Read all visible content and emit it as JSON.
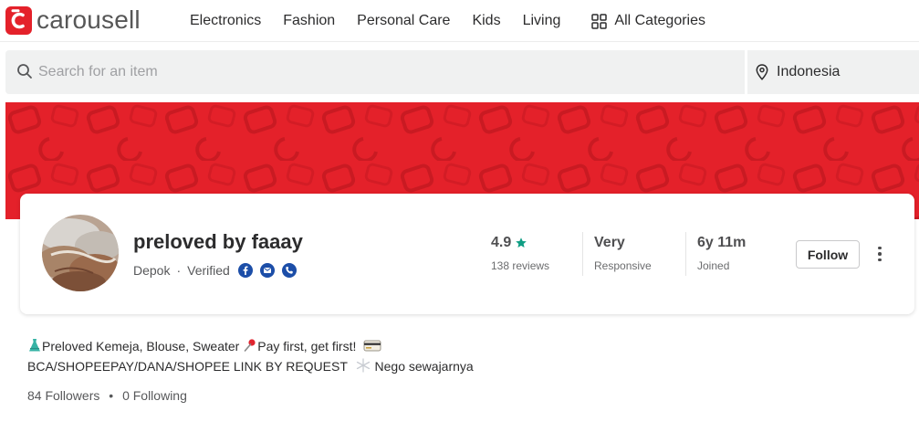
{
  "brand": {
    "logo_text": "carousell",
    "color": "#e4212a"
  },
  "nav": {
    "items": [
      "Electronics",
      "Fashion",
      "Personal Care",
      "Kids",
      "Living"
    ],
    "all_categories": "All Categories"
  },
  "search": {
    "placeholder": "Search for an item",
    "value": ""
  },
  "location": {
    "label": "Indonesia"
  },
  "profile": {
    "name": "preloved by faaay",
    "city": "Depok",
    "separator": "·",
    "verified": "Verified",
    "verified_channels": [
      "facebook-icon",
      "email-icon",
      "phone-icon"
    ],
    "rating": {
      "value": "4.9",
      "sub": "138 reviews",
      "star_color": "#0f9e84"
    },
    "responsiveness": {
      "value": "Very",
      "sub": "Responsive"
    },
    "tenure": {
      "value": "6y 11m",
      "sub": "Joined"
    },
    "follow_label": "Follow"
  },
  "bio": {
    "line1_a": "Preloved Kemeja, Blouse, Sweater",
    "line1_b": "Pay first, get first!",
    "line2_a": "BCA/SHOPEEPAY/DANA/SHOPEE LINK BY REQUEST",
    "line2_b": "Nego sewajarnya"
  },
  "social_counts": {
    "followers": "84 Followers",
    "separator": "•",
    "following": "0 Following"
  }
}
